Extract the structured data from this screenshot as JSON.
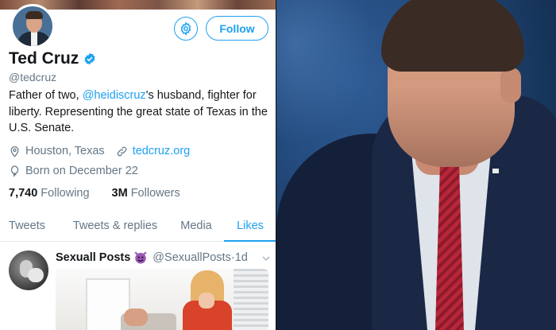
{
  "profile": {
    "name": "Ted Cruz",
    "handle": "@tedcruz",
    "bio_pre": "Father of two, ",
    "bio_mention": "@heidiscruz",
    "bio_post": "'s husband, fighter for liberty. Representing the great state of Texas in the U.S. Senate.",
    "location": "Houston, Texas",
    "website": "tedcruz.org",
    "birthday": "Born on December 22",
    "following_count": "7,740",
    "following_label": "Following",
    "followers_count": "3M",
    "followers_label": "Followers",
    "follow_button": "Follow",
    "verified": true
  },
  "tabs": [
    {
      "label": "Tweets",
      "active": false
    },
    {
      "label": "Tweets & replies",
      "active": false
    },
    {
      "label": "Media",
      "active": false
    },
    {
      "label": "Likes",
      "active": true
    }
  ],
  "liked_tweet": {
    "author_name": "Sexuall Posts",
    "author_emoji": "devil-emoji",
    "author_handle": "@SexuallPosts",
    "separator": "·",
    "time": "1d"
  },
  "icons": {
    "settings": "gear-icon",
    "verified": "verified-badge-icon",
    "location": "location-pin-icon",
    "website": "link-icon",
    "birthday": "balloon-icon",
    "caret": "chevron-down-icon"
  },
  "colors": {
    "accent": "#1da1f2",
    "secondary_text": "#657786",
    "primary_text": "#14171a"
  }
}
